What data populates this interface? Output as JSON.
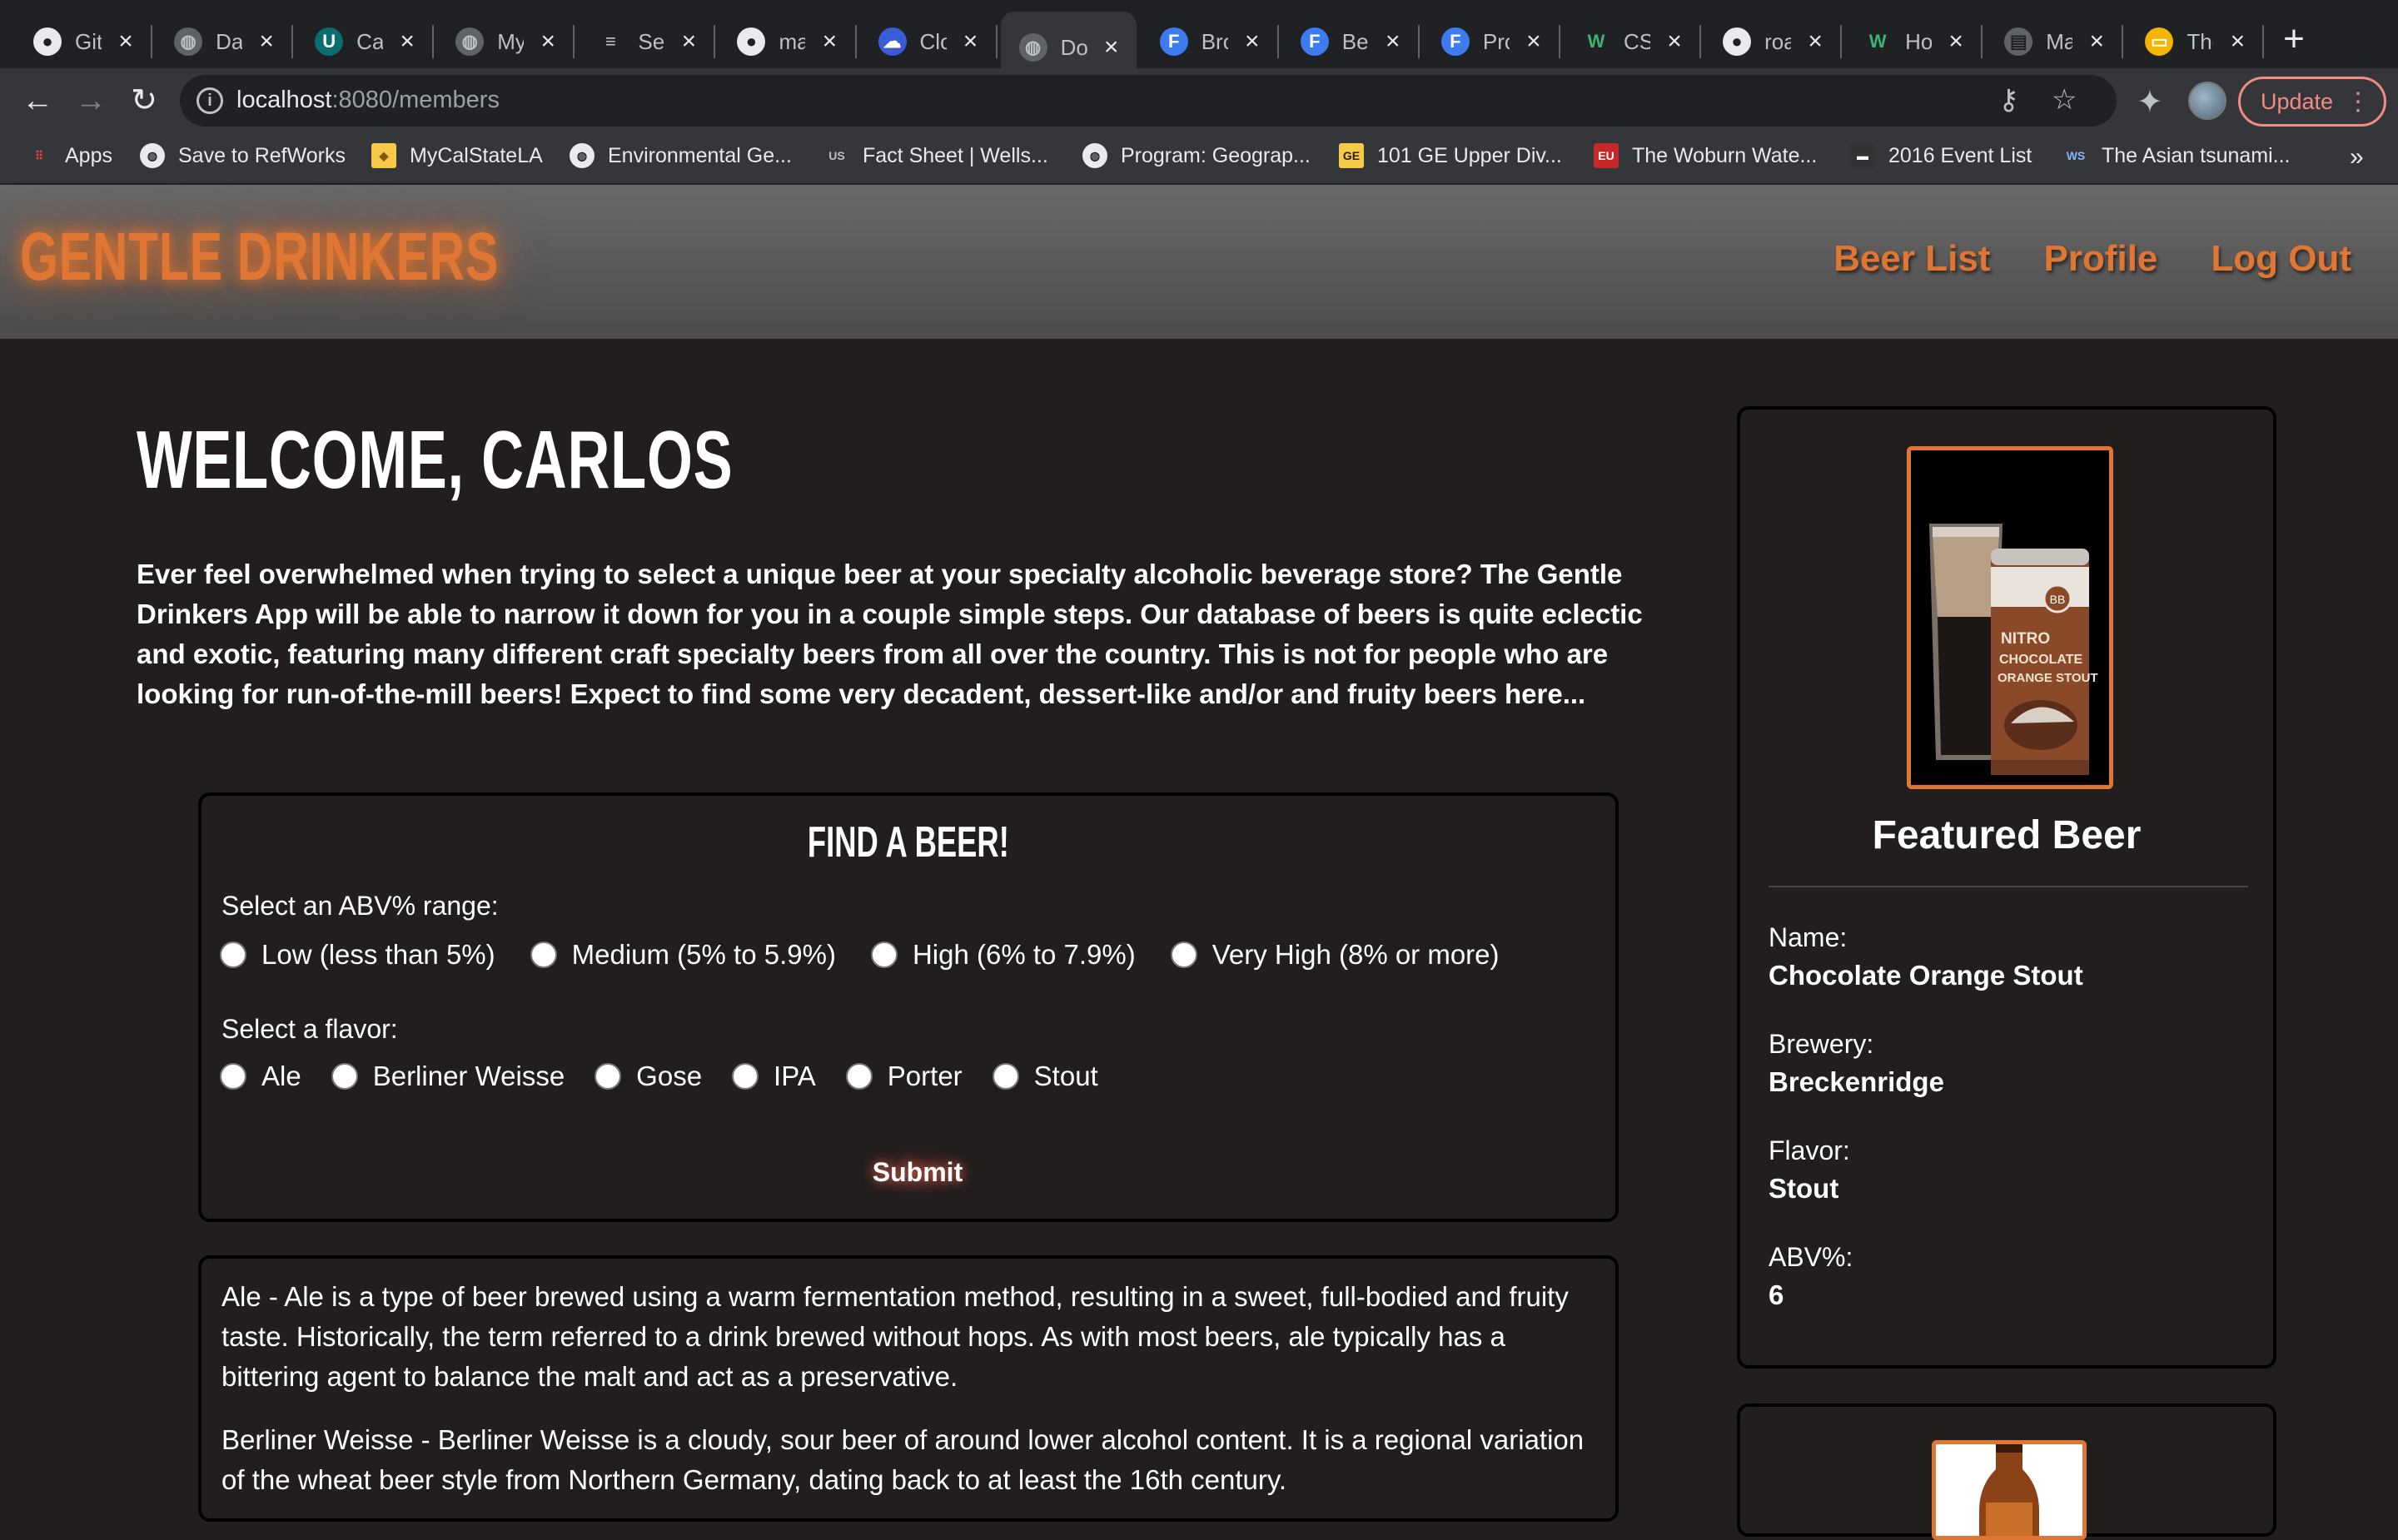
{
  "browser": {
    "tabs": [
      {
        "title": "GitHub",
        "icon": "github-icon"
      },
      {
        "title": "Dashboard",
        "icon": "globe-icon"
      },
      {
        "title": "Canvas",
        "icon": "magnet-icon"
      },
      {
        "title": "My",
        "icon": "globe-icon"
      },
      {
        "title": "Sequelize",
        "icon": "list-icon"
      },
      {
        "title": "main",
        "icon": "github-icon"
      },
      {
        "title": "Cloud",
        "icon": "cloud-icon"
      },
      {
        "title": "Docs",
        "icon": "globe-icon",
        "active": true
      },
      {
        "title": "Browse",
        "icon": "f-icon"
      },
      {
        "title": "Beer",
        "icon": "f-icon"
      },
      {
        "title": "Profile",
        "icon": "f-icon"
      },
      {
        "title": "CSS",
        "icon": "w-icon"
      },
      {
        "title": "roadmap",
        "icon": "github-icon"
      },
      {
        "title": "How",
        "icon": "w-icon"
      },
      {
        "title": "Make",
        "icon": "doc-icon"
      },
      {
        "title": "The",
        "icon": "slides-icon"
      }
    ],
    "url_host": "localhost",
    "url_rest": ":8080/members",
    "update_label": "Update",
    "bookmarks": [
      {
        "label": "Apps",
        "icon": "apps-grid-icon"
      },
      {
        "label": "Save to RefWorks",
        "icon": "globe-icon"
      },
      {
        "label": "MyCalStateLA",
        "icon": "shield-icon"
      },
      {
        "label": "Environmental Ge...",
        "icon": "globe-icon"
      },
      {
        "label": "Fact Sheet | Wells...",
        "icon": "epa-icon"
      },
      {
        "label": "Program: Geograp...",
        "icon": "globe-icon"
      },
      {
        "label": "101 GE Upper Div...",
        "icon": "ge-icon"
      },
      {
        "label": "The Woburn Wate...",
        "icon": "eu-icon"
      },
      {
        "label": "2016 Event List",
        "icon": "event-icon"
      },
      {
        "label": "The Asian tsunami...",
        "icon": "ws-icon"
      }
    ]
  },
  "site": {
    "logo": "GENTLE DRINKERS",
    "nav": [
      "Beer List",
      "Profile",
      "Log Out"
    ],
    "welcome": "WELCOME, CARLOS",
    "intro": "Ever feel overwhelmed when trying to select a unique beer at your specialty alcoholic beverage store? The Gentle Drinkers App will be able to narrow it down for you in a couple simple steps. Our database of beers is quite eclectic and exotic, featuring many different craft specialty beers from all over the country. This is not for people who are looking for run-of-the-mill beers! Expect to find some very decadent, dessert-like and/or and fruity beers here...",
    "find": {
      "title": "FIND A BEER!",
      "abv_label": "Select an ABV% range:",
      "abv_options": [
        "Low (less than 5%)",
        "Medium (5% to 5.9%)",
        "High (6% to 7.9%)",
        "Very High (8% or more)"
      ],
      "flavor_label": "Select a flavor:",
      "flavor_options": [
        "Ale",
        "Berliner Weisse",
        "Gose",
        "IPA",
        "Porter",
        "Stout"
      ],
      "submit": "Submit"
    },
    "descriptions": [
      "Ale - Ale is a type of beer brewed using a warm fermentation method, resulting in a sweet, full-bodied and fruity taste. Historically, the term referred to a drink brewed without hops. As with most beers, ale typically has a bittering agent to balance the malt and act as a preservative.",
      "Berliner Weisse - Berliner Weisse is a cloudy, sour beer of around lower alcohol content. It is a regional variation of the wheat beer style from Northern Germany, dating back to at least the 16th century."
    ],
    "featured": {
      "title": "Featured Beer",
      "can_text": "NITRO CHOCOLATE ORANGE STOUT",
      "can_badge": "BB",
      "name_label": "Name:",
      "name": "Chocolate Orange Stout",
      "brewery_label": "Brewery:",
      "brewery": "Breckenridge",
      "flavor_label": "Flavor:",
      "flavor": "Stout",
      "abv_label": "ABV%:",
      "abv": "6"
    }
  },
  "colors": {
    "accent": "#e07634",
    "page_bg": "#211e1d",
    "header_bg": "#5a5a5a"
  }
}
